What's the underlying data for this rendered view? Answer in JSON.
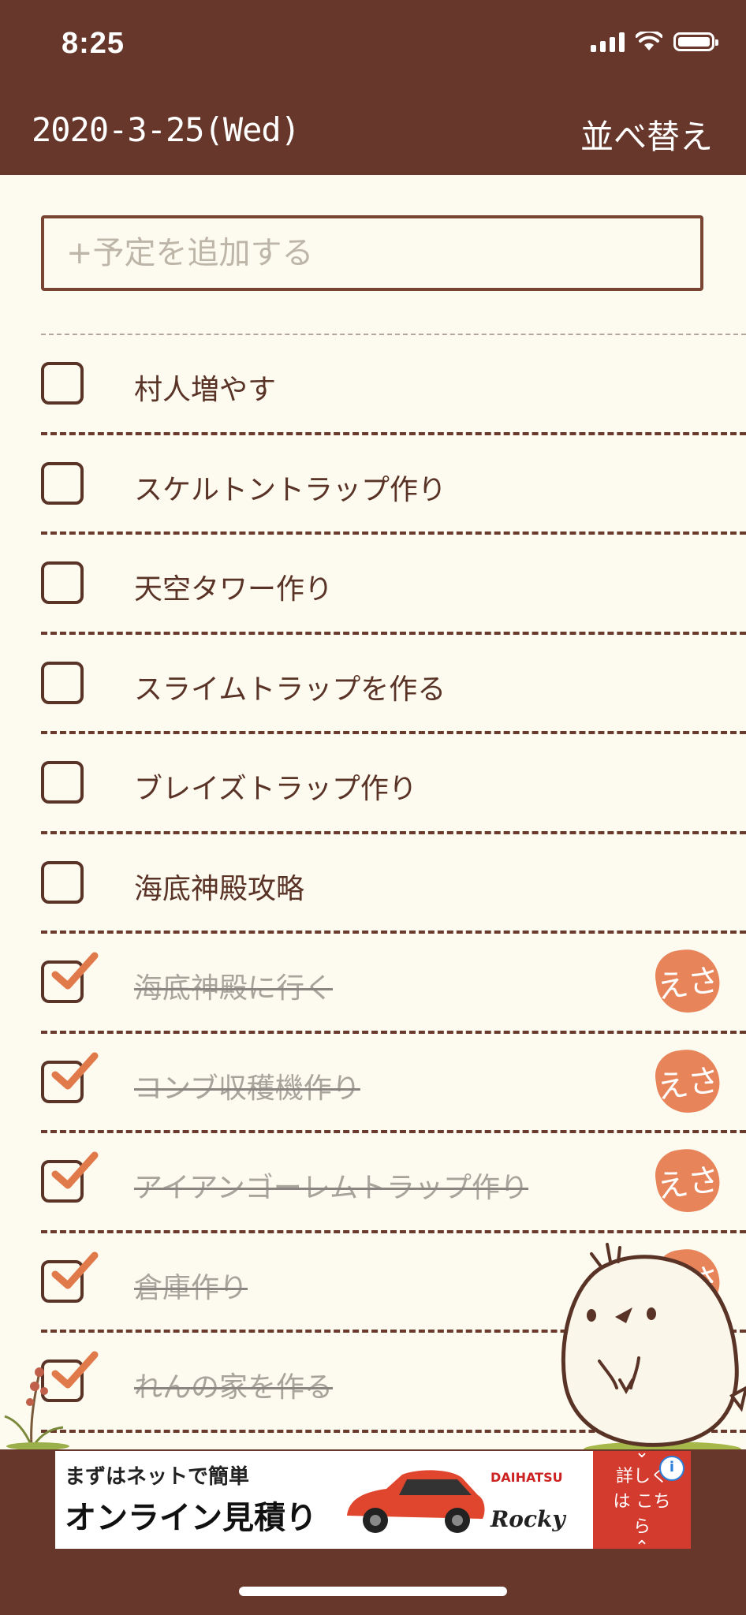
{
  "status_bar": {
    "time": "8:25"
  },
  "header": {
    "date": "2020-3-25(Wed)",
    "sort_label": "並べ替え"
  },
  "add_input": {
    "placeholder": "+予定を追加する"
  },
  "tasks": [
    {
      "label": "村人増やす",
      "done": false
    },
    {
      "label": "スケルトントラップ作り",
      "done": false
    },
    {
      "label": "天空タワー作り",
      "done": false
    },
    {
      "label": "スライムトラップを作る",
      "done": false
    },
    {
      "label": "ブレイズトラップ作り",
      "done": false
    },
    {
      "label": "海底神殿攻略",
      "done": false
    },
    {
      "label": "海底神殿に行く",
      "done": true,
      "stamp": "えさ"
    },
    {
      "label": "コンブ収穫機作り",
      "done": true,
      "stamp": "えさ"
    },
    {
      "label": "アイアンゴーレムトラップ作り",
      "done": true,
      "stamp": "えさ"
    },
    {
      "label": "倉庫作り",
      "done": true,
      "stamp": "えさ"
    },
    {
      "label": "れんの家を作る",
      "done": true
    }
  ],
  "ad": {
    "line1": "まずはネットで簡単",
    "line2": "オンライン見積り",
    "brand": "DAIHATSU",
    "model": "Rocky",
    "cta": "詳しくは こちら",
    "info": "i"
  },
  "colors": {
    "header_bg": "#67372b",
    "page_bg": "#fdfaf0",
    "text": "#5a3327",
    "check_accent": "#e07a4a",
    "ad_cta": "#d23b2e"
  },
  "icons": [
    "signal-icon",
    "wifi-icon",
    "battery-icon",
    "checkmark-icon",
    "bird-mascot",
    "plant-decoration"
  ]
}
